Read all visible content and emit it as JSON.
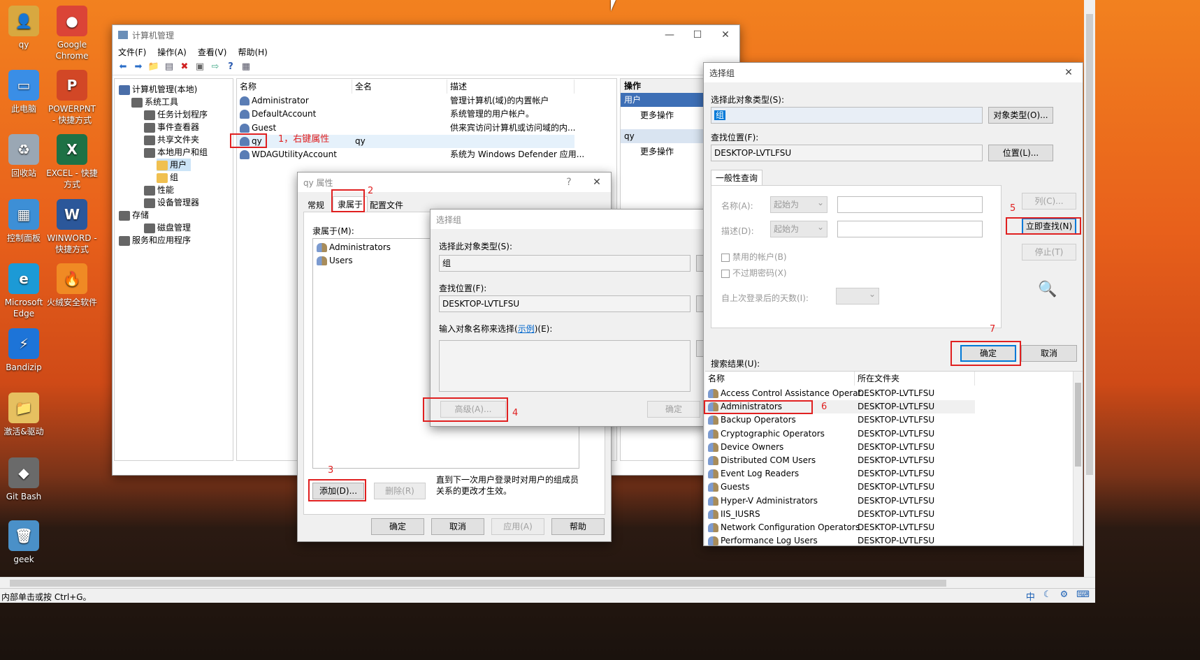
{
  "desktop": {
    "icons": [
      {
        "label": "qy",
        "color": "#d8a840",
        "glyph": "👤"
      },
      {
        "label": "Google Chrome",
        "color": "#db4437",
        "glyph": "●"
      },
      {
        "label": "此电脑",
        "color": "#3a8ee6",
        "glyph": "▭"
      },
      {
        "label": "POWERPNT - 快捷方式",
        "color": "#d24726",
        "glyph": "P"
      },
      {
        "label": "回收站",
        "color": "#9aa7b4",
        "glyph": "♻"
      },
      {
        "label": "EXCEL - 快捷方式",
        "color": "#1e7145",
        "glyph": "X"
      },
      {
        "label": "控制面板",
        "color": "#3d8fd6",
        "glyph": "▦"
      },
      {
        "label": "WINWORD - 快捷方式",
        "color": "#2b579a",
        "glyph": "W"
      },
      {
        "label": "Microsoft Edge",
        "color": "#1c9ad6",
        "glyph": "e"
      },
      {
        "label": "火绒安全软件",
        "color": "#f08a24",
        "glyph": "🔥"
      },
      {
        "label": "Bandizip",
        "color": "#1d74d8",
        "glyph": "⚡"
      },
      {
        "label": "激活&驱动",
        "color": "#e6c060",
        "glyph": "📁"
      },
      {
        "label": "Git Bash",
        "color": "#6a6a6a",
        "glyph": "◆"
      },
      {
        "label": "geek",
        "color": "#4a90c8",
        "glyph": "🗑"
      }
    ]
  },
  "cm": {
    "title": "计算机管理",
    "menu": [
      "文件(F)",
      "操作(A)",
      "查看(V)",
      "帮助(H)"
    ],
    "tree": [
      {
        "label": "计算机管理(本地)"
      },
      {
        "label": "系统工具"
      },
      {
        "label": "任务计划程序"
      },
      {
        "label": "事件查看器"
      },
      {
        "label": "共享文件夹"
      },
      {
        "label": "本地用户和组"
      },
      {
        "label": "用户"
      },
      {
        "label": "组"
      },
      {
        "label": "性能"
      },
      {
        "label": "设备管理器"
      },
      {
        "label": "存储"
      },
      {
        "label": "磁盘管理"
      },
      {
        "label": "服务和应用程序"
      }
    ],
    "columns": [
      "名称",
      "全名",
      "描述"
    ],
    "rows": [
      {
        "name": "Administrator",
        "full": "",
        "desc": "管理计算机(域)的内置帐户"
      },
      {
        "name": "DefaultAccount",
        "full": "",
        "desc": "系统管理的用户帐户。"
      },
      {
        "name": "Guest",
        "full": "",
        "desc": "供来宾访问计算机或访问域的内..."
      },
      {
        "name": "qy",
        "full": "qy",
        "desc": ""
      },
      {
        "name": "WDAGUtilityAccount",
        "full": "",
        "desc": "系统为 Windows Defender 应用..."
      }
    ],
    "actions": {
      "header": "操作",
      "sec1": "用户",
      "more1": "更多操作",
      "sec2": "qy",
      "more2": "更多操作"
    }
  },
  "props": {
    "title": "qy 属性",
    "help": "?",
    "tabs": [
      "常规",
      "隶属于",
      "配置文件"
    ],
    "member_label": "隶属于(M):",
    "members": [
      "Administrators",
      "Users"
    ],
    "add": "添加(D)...",
    "remove": "删除(R)",
    "note": "直到下一次用户登录时对用户的组成员关系的更改才生效。",
    "ok": "确定",
    "cancel": "取消",
    "apply": "应用(A)",
    "helpbtn": "帮助"
  },
  "sg_small": {
    "title": "选择组",
    "type_label": "选择此对象类型(S):",
    "type_value": "组",
    "loc_label": "查找位置(F):",
    "loc_value": "DESKTOP-LVTLFSU",
    "enter_label_pre": "输入对象名称来选择(",
    "enter_link": "示例",
    "enter_label_post": ")(E):",
    "advanced": "高级(A)...",
    "ok": "确定"
  },
  "sg_big": {
    "title": "选择组",
    "type_label": "选择此对象类型(S):",
    "type_value": "组",
    "type_btn": "对象类型(O)...",
    "loc_label": "查找位置(F):",
    "loc_value": "DESKTOP-LVTLFSU",
    "loc_btn": "位置(L)...",
    "tab": "一般性查询",
    "name_label": "名称(A):",
    "desc_label": "描述(D):",
    "starts": "起始为",
    "disabled": "禁用的帐户(B)",
    "noexpire": "不过期密码(X)",
    "days": "自上次登录后的天数(I):",
    "col_btn": "列(C)...",
    "find_btn": "立即查找(N)",
    "stop_btn": "停止(T)",
    "ok": "确定",
    "cancel": "取消",
    "results_label": "搜索结果(U):",
    "result_cols": [
      "名称",
      "所在文件夹"
    ],
    "results": [
      {
        "name": "Access Control Assistance Operat...",
        "folder": "DESKTOP-LVTLFSU"
      },
      {
        "name": "Administrators",
        "folder": "DESKTOP-LVTLFSU"
      },
      {
        "name": "Backup Operators",
        "folder": "DESKTOP-LVTLFSU"
      },
      {
        "name": "Cryptographic Operators",
        "folder": "DESKTOP-LVTLFSU"
      },
      {
        "name": "Device Owners",
        "folder": "DESKTOP-LVTLFSU"
      },
      {
        "name": "Distributed COM Users",
        "folder": "DESKTOP-LVTLFSU"
      },
      {
        "name": "Event Log Readers",
        "folder": "DESKTOP-LVTLFSU"
      },
      {
        "name": "Guests",
        "folder": "DESKTOP-LVTLFSU"
      },
      {
        "name": "Hyper-V Administrators",
        "folder": "DESKTOP-LVTLFSU"
      },
      {
        "name": "IIS_IUSRS",
        "folder": "DESKTOP-LVTLFSU"
      },
      {
        "name": "Network Configuration Operators",
        "folder": "DESKTOP-LVTLFSU"
      },
      {
        "name": "Performance Log Users",
        "folder": "DESKTOP-LVTLFSU"
      }
    ]
  },
  "annotations": {
    "a1": "1，右键属性",
    "a2": "2",
    "a3": "3",
    "a4": "4",
    "a5": "5",
    "a6": "6",
    "a7": "7"
  },
  "statusbar": {
    "text": "内部单击或按 Ctrl+G。",
    "tray": [
      "中",
      "☾",
      "⚙",
      "⌨"
    ]
  }
}
